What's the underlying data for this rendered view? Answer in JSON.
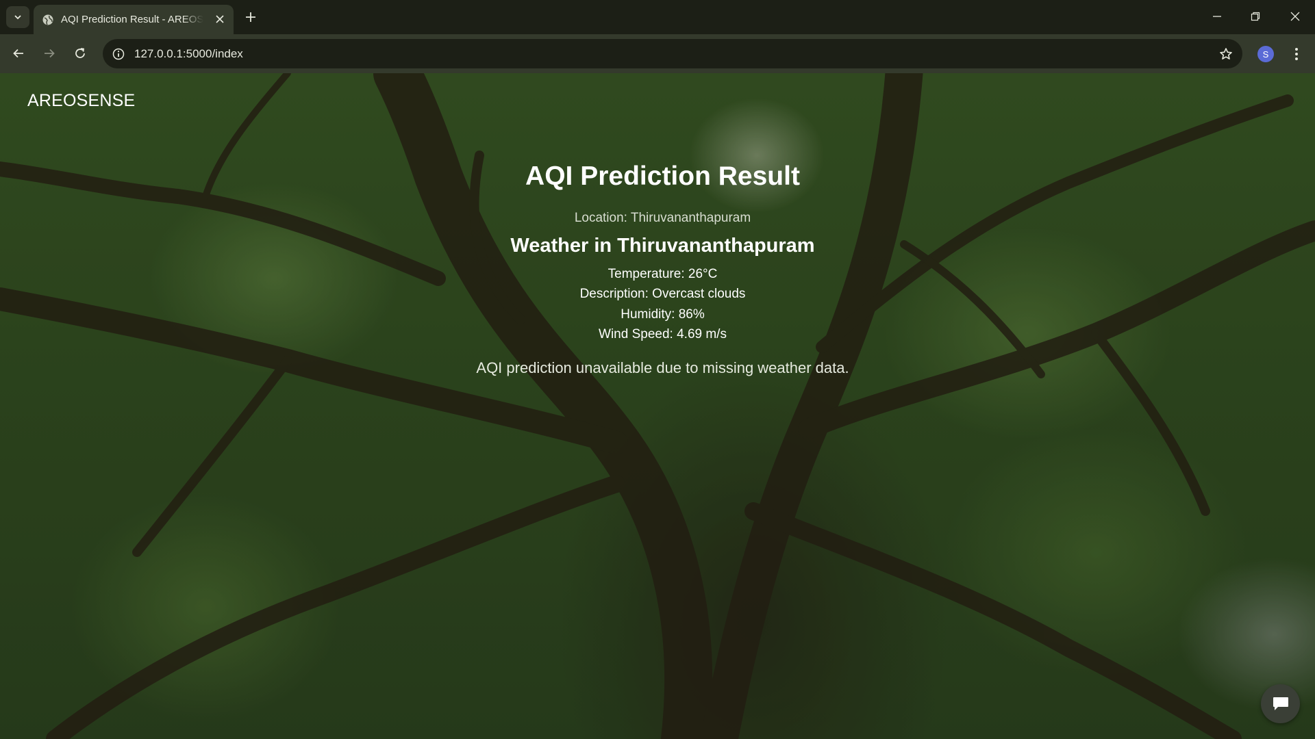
{
  "browser": {
    "tab_title": "AQI Prediction Result - AREOSENSE",
    "url": "127.0.0.1:5000/index",
    "profile_initial": "S"
  },
  "page": {
    "brand": "AREOSENSE",
    "title": "AQI Prediction Result",
    "location": "Location: Thiruvananthapuram",
    "weather_heading": "Weather in Thiruvananthapuram",
    "weather": {
      "temperature": "Temperature: 26°C",
      "description": "Description: Overcast clouds",
      "humidity": "Humidity: 86%",
      "wind_speed": "Wind Speed: 4.69 m/s"
    },
    "aqi_message": "AQI prediction unavailable due to missing weather data."
  },
  "icons": {
    "tab_list": "chevron-down-icon",
    "favicon": "globe-icon",
    "tab_close": "close-icon",
    "new_tab": "plus-icon",
    "back": "arrow-left-icon",
    "forward": "arrow-right-icon",
    "reload": "reload-icon",
    "site_info": "info-icon",
    "bookmark": "star-icon",
    "menu": "kebab-menu-icon",
    "chat": "chat-bubble-icon"
  },
  "colors": {
    "chrome_dark": "#1c1f16",
    "chrome_toolbar": "#343a2c",
    "profile_accent": "#5b6bd6",
    "foliage": "#3b5a26"
  }
}
